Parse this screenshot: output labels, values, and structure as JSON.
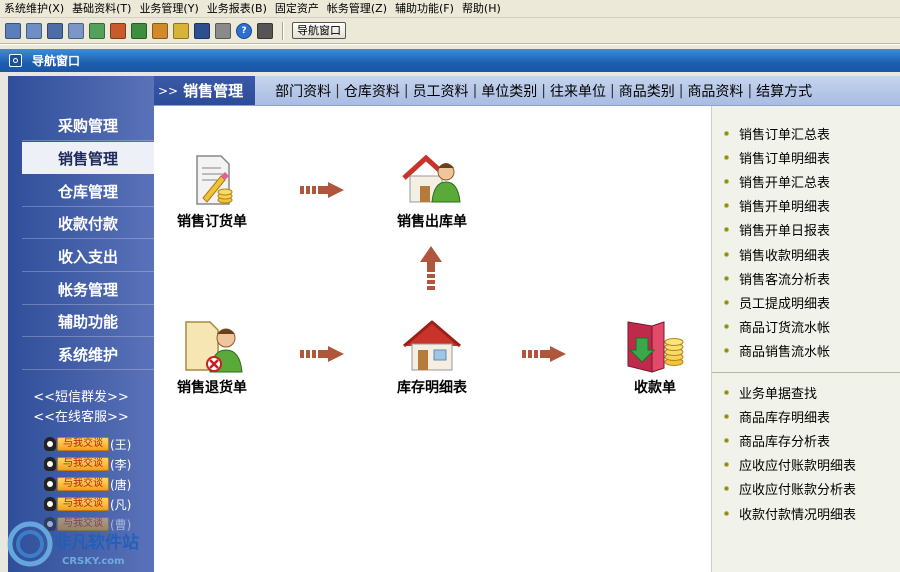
{
  "menubar": {
    "items": [
      "系统维护(X)",
      "基础资料(T)",
      "业务管理(Y)",
      "业务报表(B)",
      "固定资产",
      "帐务管理(Z)",
      "辅助功能(F)",
      "帮助(H)"
    ]
  },
  "toolbar": {
    "icons": [
      "window-icon",
      "window-icon",
      "window-icon",
      "window-icon",
      "window-icon",
      "chart-icon",
      "network-icon",
      "tool-icon",
      "folder-icon",
      "save-icon",
      "print-icon",
      "help-icon",
      "exit-icon"
    ],
    "nav_button_label": "导航窗口"
  },
  "window": {
    "title": "导航窗口"
  },
  "sidebar": {
    "items": [
      {
        "label": "采购管理",
        "active": false
      },
      {
        "label": "销售管理",
        "active": true
      },
      {
        "label": "仓库管理",
        "active": false
      },
      {
        "label": "收款付款",
        "active": false
      },
      {
        "label": "收入支出",
        "active": false
      },
      {
        "label": "帐务管理",
        "active": false
      },
      {
        "label": "辅助功能",
        "active": false
      },
      {
        "label": "系统维护",
        "active": false
      }
    ],
    "links": [
      "<<短信群发>>",
      "<<在线客服>>"
    ],
    "qq": [
      {
        "button": "与我交谈",
        "name": "(王)"
      },
      {
        "button": "与我交谈",
        "name": "(李)"
      },
      {
        "button": "与我交谈",
        "name": "(唐)"
      },
      {
        "button": "与我交谈",
        "name": "(凡)"
      },
      {
        "button": "与我交谈",
        "name": "(曹)"
      }
    ]
  },
  "topnav": {
    "prefix": ">>",
    "title": "销售管理",
    "links": [
      "部门资料",
      "仓库资料",
      "员工资料",
      "单位类别",
      "往来单位",
      "商品类别",
      "商品资料",
      "结算方式"
    ]
  },
  "flow": {
    "order": "销售订货单",
    "outbound": "销售出库单",
    "return": "销售退货单",
    "inventory": "库存明细表",
    "receipt": "收款单"
  },
  "reports": {
    "group1": [
      "销售订单汇总表",
      "销售订单明细表",
      "销售开单汇总表",
      "销售开单明细表",
      "销售开单日报表",
      "销售收款明细表",
      "销售客流分析表",
      "员工提成明细表",
      "商品订货流水帐",
      "商品销售流水帐"
    ],
    "group2": [
      "业务单据查找",
      "商品库存明细表",
      "商品库存分析表",
      "应收应付账款明细表",
      "应收应付账款分析表",
      "收款付款情况明细表"
    ]
  },
  "watermark": {
    "text": "非凡软件站",
    "sub": "CRSKY.com"
  },
  "colors": {
    "sidebar": "#3a58a6",
    "titlebar": "#1e5fb0",
    "arrow": "#b0563a",
    "active": "#eef0f8"
  }
}
